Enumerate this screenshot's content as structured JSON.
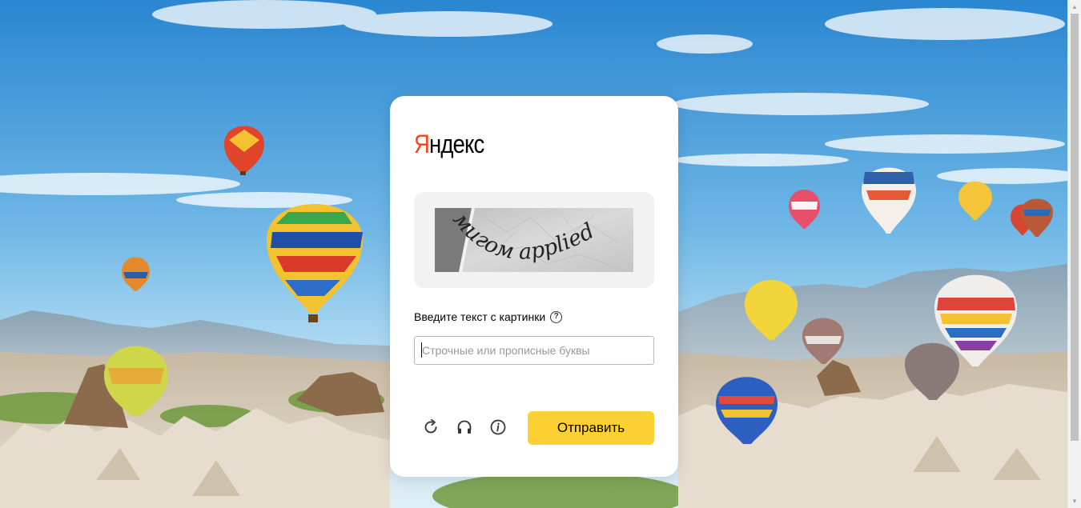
{
  "logo": {
    "first_letter": "Я",
    "rest": "ндекс"
  },
  "captcha": {
    "text": "мигом applied"
  },
  "prompt": {
    "label": "Введите текст с картинки",
    "help": "?"
  },
  "answer": {
    "value": "",
    "placeholder": "Строчные или прописные буквы"
  },
  "actions": {
    "reload_icon": "reload-icon",
    "audio_icon": "headphones-icon",
    "info_icon": "info-icon",
    "submit_label": "Отправить"
  },
  "colors": {
    "brand_red": "#fc3f1d",
    "submit_yellow": "#fdd033",
    "sky_top": "#2e8fd6",
    "sky_bottom": "#bfe3f5"
  }
}
